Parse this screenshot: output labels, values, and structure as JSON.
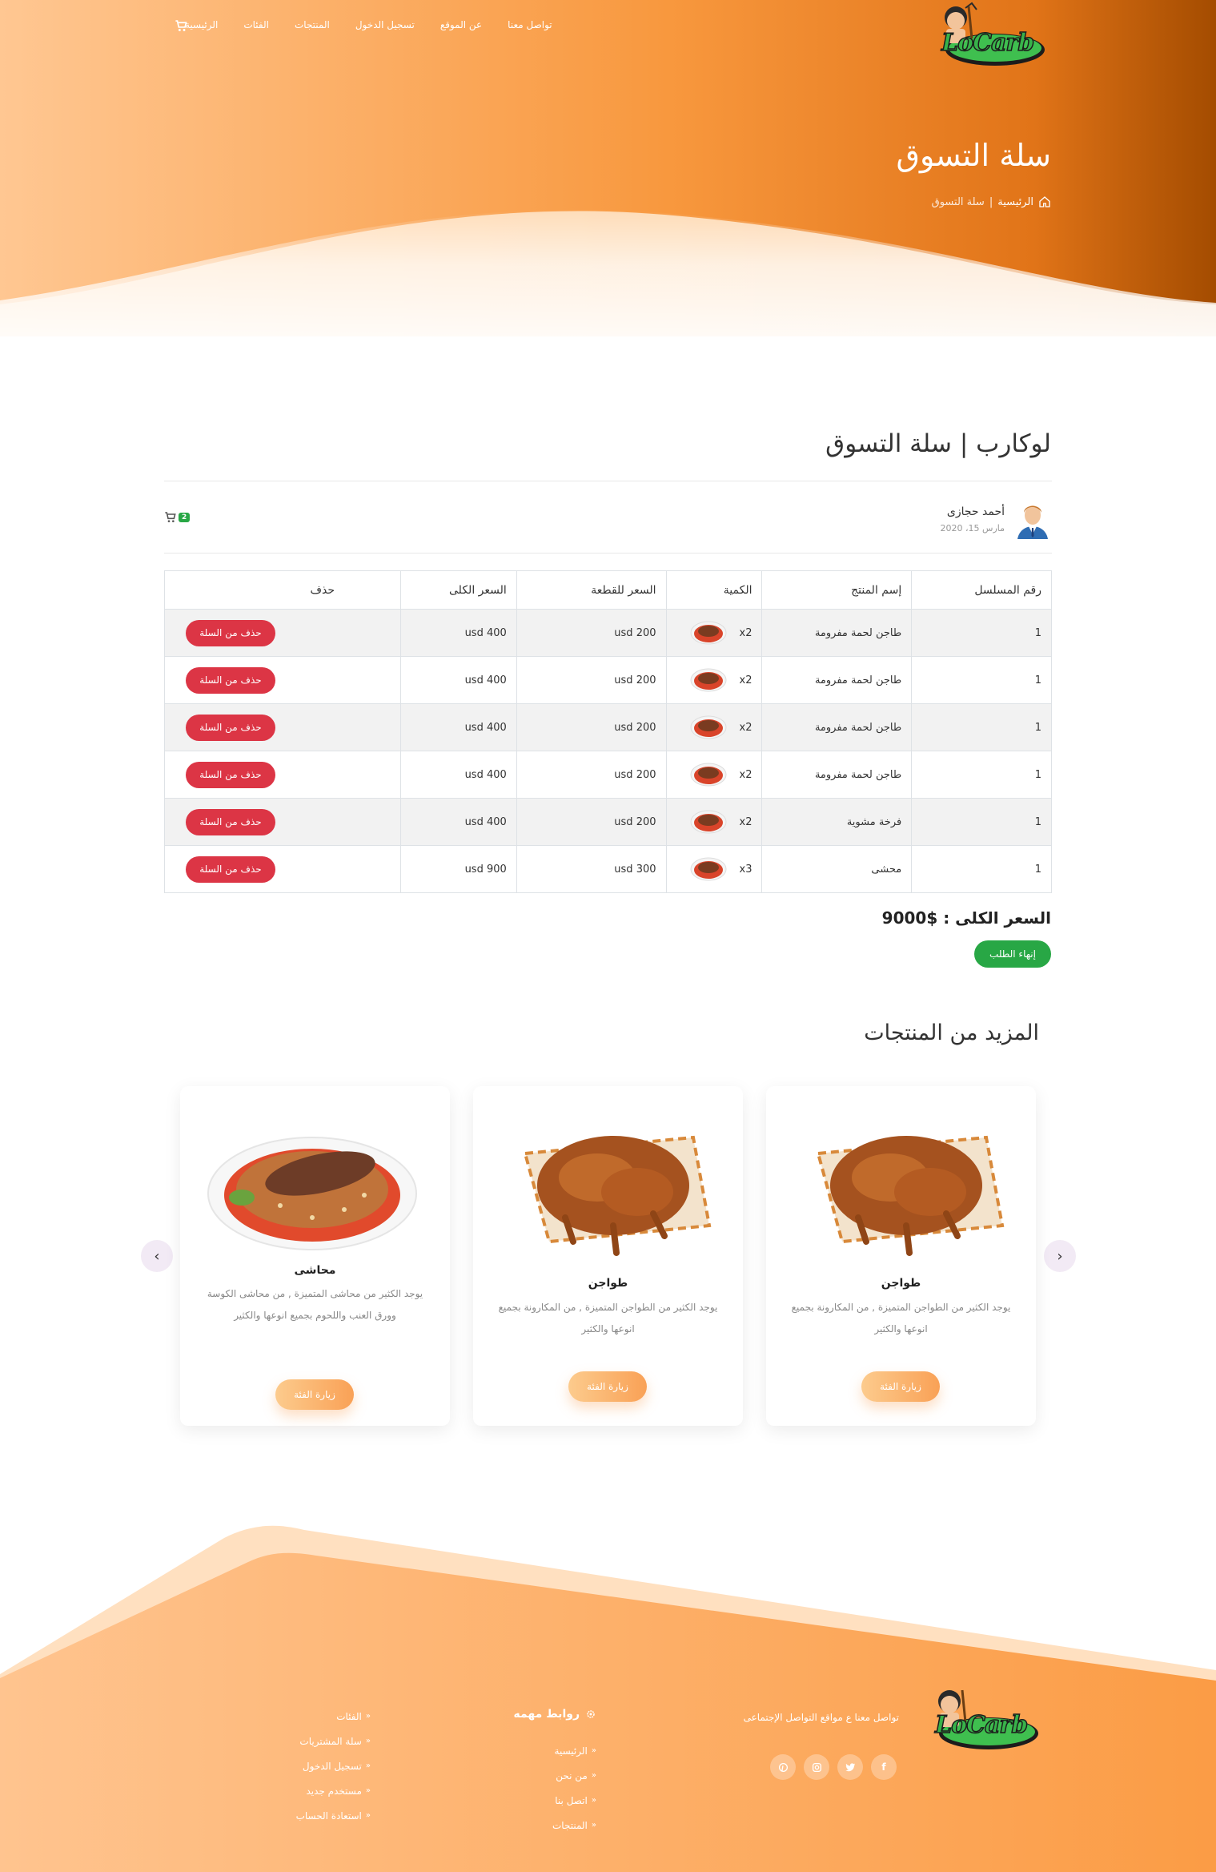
{
  "nav": {
    "links": [
      "الرئيسية",
      "الفئات",
      "المنتجات",
      "تسجيل الدخول",
      "عن الموقع",
      "تواصل معنا"
    ]
  },
  "brand": {
    "logo_text": "LoCarb"
  },
  "hero": {
    "title": "سلة التسوق",
    "breadcrumb_home": "الرئيسية",
    "breadcrumb_sep": "|",
    "breadcrumb_current": "سلة التسوق"
  },
  "cart": {
    "heading": "لوكارب | سلة التسوق",
    "user_name": "أحمد حجازى",
    "user_date": "مارس 15، 2020",
    "badge_count": "2",
    "columns": [
      "رقم المسلسل",
      "إسم المنتج",
      "الكمية",
      "السعر للقطعة",
      "السعر الكلى",
      "حذف"
    ],
    "rows": [
      {
        "serial": "1",
        "name": "طاجن لحمة مفرومة",
        "qty": "x2",
        "unit": "usd 200",
        "total": "usd 400",
        "action": "حذف من السلة"
      },
      {
        "serial": "1",
        "name": "طاجن لحمة مفرومة",
        "qty": "x2",
        "unit": "usd 200",
        "total": "usd 400",
        "action": "حذف من السلة"
      },
      {
        "serial": "1",
        "name": "طاجن لحمة مفرومة",
        "qty": "x2",
        "unit": "usd 200",
        "total": "usd 400",
        "action": "حذف من السلة"
      },
      {
        "serial": "1",
        "name": "طاجن لحمة مفرومة",
        "qty": "x2",
        "unit": "usd 200",
        "total": "usd 400",
        "action": "حذف من السلة"
      },
      {
        "serial": "1",
        "name": "فرخة مشوية",
        "qty": "x2",
        "unit": "usd 200",
        "total": "usd 400",
        "action": "حذف من السلة"
      },
      {
        "serial": "1",
        "name": "محشى",
        "qty": "x3",
        "unit": "usd 300",
        "total": "usd 900",
        "action": "حذف من السلة"
      }
    ],
    "total_label": "السعر الكلى : $9000",
    "finish_label": "إنهاء الطلب"
  },
  "more": {
    "title": "المزيد من المنتجات",
    "cards": [
      {
        "name": "طواجن",
        "desc": "يوجد الكثير من الطواجن المتميزة , من المكارونة بجميع انوعها والكثير",
        "button": "زيارة الفئة"
      },
      {
        "name": "طواجن",
        "desc": "يوجد الكثير من الطواجن المتميزة , من المكارونة بجميع انوعها والكثير",
        "button": "زيارة الفئة"
      },
      {
        "name": "محاشى",
        "desc": "يوجد الكثير من محاشى المتميزة , من محاشى الكوسة وورق العنب واللحوم بجميع انوعها والكثير",
        "button": "زيارة الفئة"
      }
    ]
  },
  "footer": {
    "tagline": "تواصل معنا ع مواقع التواصل الإجتماعى",
    "links_title": "روابط مهمه",
    "links_col1": [
      "الرئيسية",
      "من نحن",
      "اتصل بنا",
      "المنتجات"
    ],
    "links_col2": [
      "الفئات",
      "سلة المشتريات",
      "تسجيل الدخول",
      "مستخدم جديد",
      "استعادة الحساب"
    ]
  },
  "colors": {
    "orange_light": "#ffc48f",
    "orange_mid": "#f99a3f",
    "orange_dark": "#a74f00",
    "danger": "#dc3545",
    "success": "#28a745"
  },
  "icons": [
    "cart-icon",
    "home-icon",
    "facebook-icon",
    "twitter-icon",
    "instagram-icon",
    "pinterest-icon",
    "chevron-left-icon",
    "chevron-right-icon",
    "gear-icon"
  ]
}
